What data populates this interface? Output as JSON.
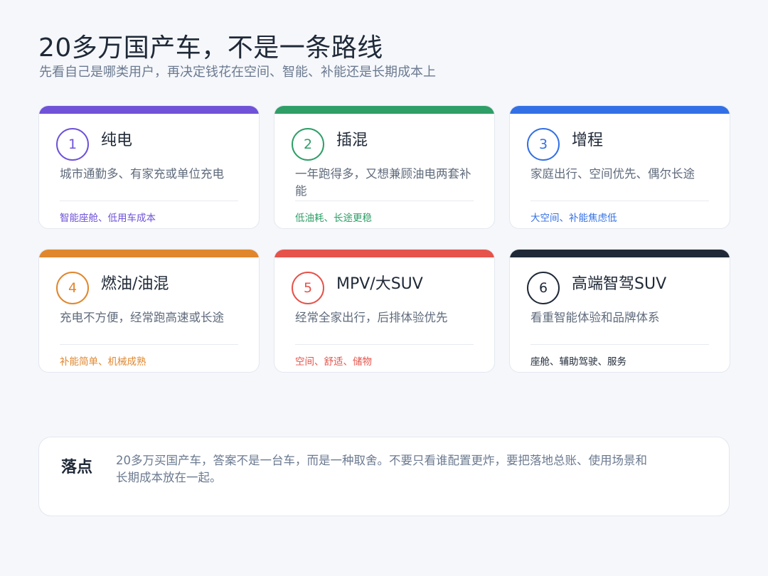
{
  "header": {
    "title": "20多万国产车，不是一条路线",
    "subtitle": "先看自己是哪类用户，再决定钱花在空间、智能、补能还是长期成本上"
  },
  "cards": [
    {
      "number": "1",
      "name": "纯电",
      "desc": "城市通勤多、有家充或单位充电",
      "tags": "智能座舱、低用车成本",
      "color": "#6f52d8"
    },
    {
      "number": "2",
      "name": "插混",
      "desc": "一年跑得多，又想兼顾油电两套补能",
      "tags": "低油耗、长途更稳",
      "color": "#2f9e67"
    },
    {
      "number": "3",
      "name": "增程",
      "desc": "家庭出行、空间优先、偶尔长途",
      "tags": "大空间、补能焦虑低",
      "color": "#3370e6"
    },
    {
      "number": "4",
      "name": "燃油/油混",
      "desc": "充电不方便，经常跑高速或长途",
      "tags": "补能简单、机械成熟",
      "color": "#e0862c"
    },
    {
      "number": "5",
      "name": "MPV/大SUV",
      "desc": "经常全家出行，后排体验优先",
      "tags": "空间、舒适、储物",
      "color": "#e5534b"
    },
    {
      "number": "6",
      "name": "高端智驾SUV",
      "desc": "看重智能体验和品牌体系",
      "tags": "座舱、辅助驾驶、服务",
      "color": "#1f2937"
    }
  ],
  "summary": {
    "label": "落点",
    "text": "20多万买国产车，答案不是一台车，而是一种取舍。不要只看谁配置更炸，要把落地总账、使用场景和长期成本放在一起。"
  }
}
